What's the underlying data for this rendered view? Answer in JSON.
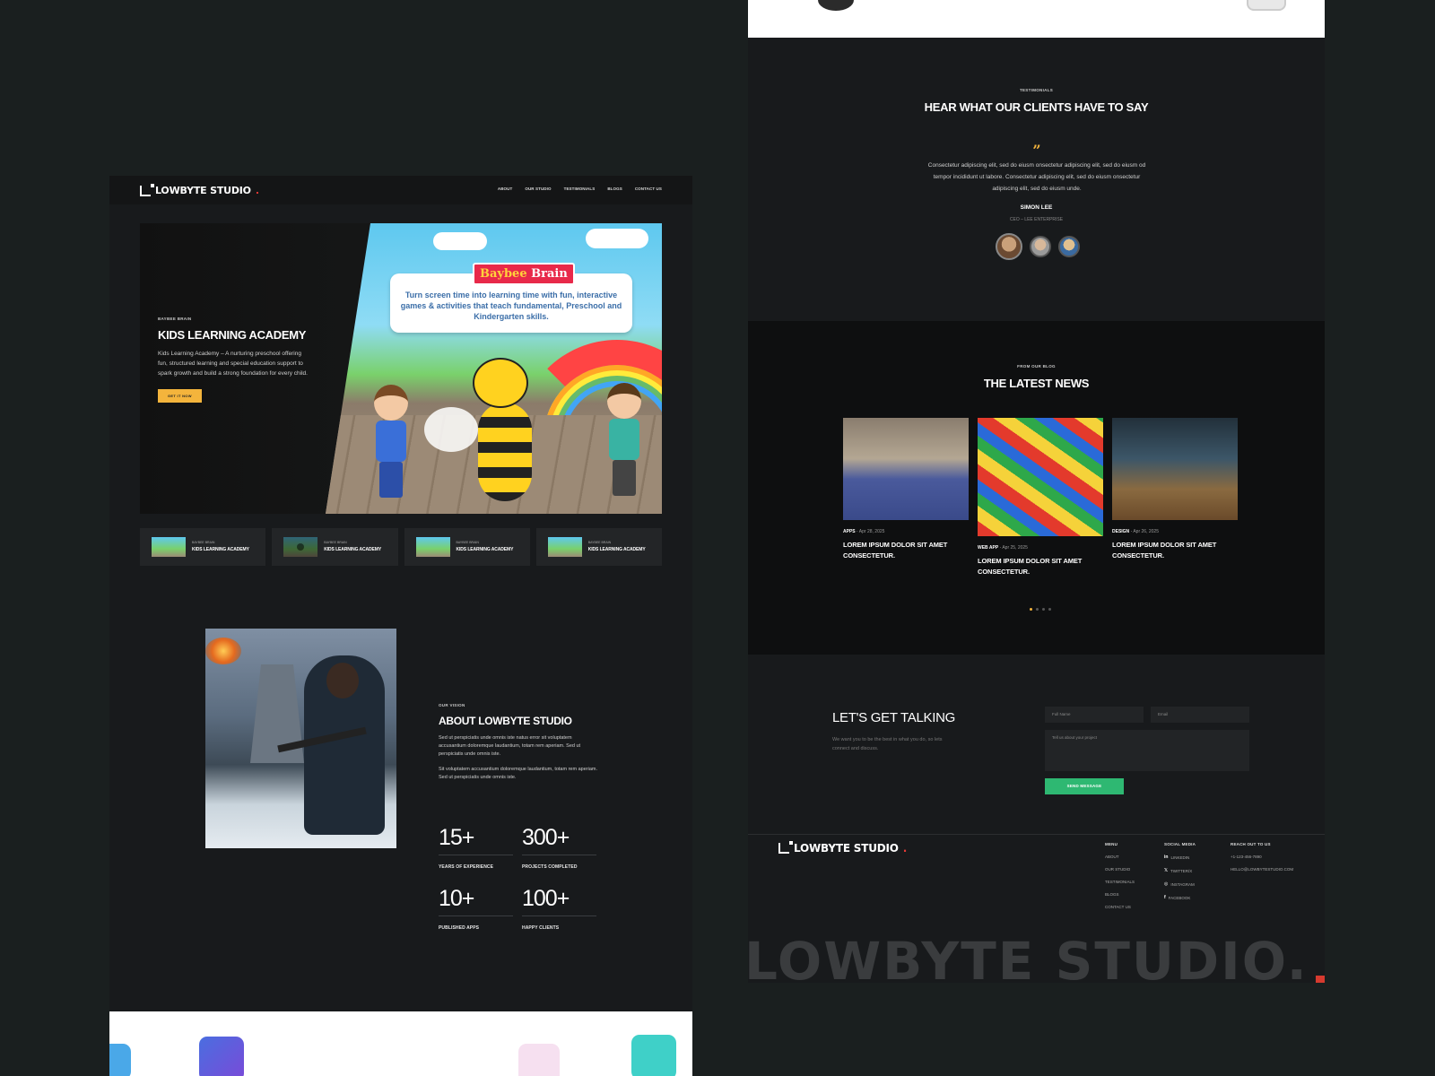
{
  "brand": {
    "name": "LOWBYTE STUDIO",
    "dot": "."
  },
  "nav": {
    "links": [
      "ABOUT",
      "OUR STUDIO",
      "TESTIMONIALS",
      "BLOGS",
      "CONTACT US"
    ]
  },
  "hero": {
    "eyebrow": "BAYBEE BRAIN",
    "title": "KIDS LEARNING ACADEMY",
    "description": "Kids Learning Academy – A nurturing preschool offering fun, structured learning and special education support to spark growth and build a strong foundation for every child.",
    "cta": "GET IT NOW",
    "art_brand_a": "Baybee",
    "art_brand_b": " Brain",
    "art_tagline": "Turn screen time into learning time with fun, interactive games & activities that teach fundamental, Preschool and Kindergarten skills."
  },
  "thumbs": [
    {
      "eyebrow": "BAYBEE BRAIN",
      "title": "KIDS LEARNING ACADEMY",
      "video": false
    },
    {
      "eyebrow": "BAYBEE BRAIN",
      "title": "KIDS LEARNING ACADEMY",
      "video": true
    },
    {
      "eyebrow": "BAYBEE BRAIN",
      "title": "KIDS LEARNING ACADEMY",
      "video": false
    },
    {
      "eyebrow": "BAYBEE BRAIN",
      "title": "KIDS LEARNING ACADEMY",
      "video": false
    }
  ],
  "about": {
    "eyebrow": "OUR VISION",
    "title": "ABOUT LOWBYTE STUDIO",
    "p1": "Sed ut perspiciatis unde omnis iste natus error sit voluptatem accusantium doloremque laudantium, totam rem aperiam. Sed ut perspiciatis unde omnis iste.",
    "p2": "Sit voluptatem accusantium doloremque laudantium, totam rem aperiam. Sed ut perspiciatis unde omnis iste."
  },
  "stats": [
    {
      "num": "15+",
      "label": "YEARS OF EXPERIENCE"
    },
    {
      "num": "300+",
      "label": "PROJECTS COMPLETED"
    },
    {
      "num": "10+",
      "label": "PUBLISHED APPS"
    },
    {
      "num": "100+",
      "label": "HAPPY CLIENTS"
    }
  ],
  "testimonials": {
    "eyebrow": "TESTIMONIALS",
    "title": "HEAR WHAT OUR CLIENTS HAVE TO SAY",
    "quote_mark": "”",
    "body": "Consectetur adipiscing elit, sed do eiusm onsectetur adipiscing elit, sed do eiusm od tempor incididunt ut labore. Consectetur adipiscing elit, sed do eiusm onsectetur adipiscing elit, sed do eiusm unde.",
    "name": "SIMON LEE",
    "role": "CEO – LEE ENTERPRISE"
  },
  "news": {
    "eyebrow": "FROM OUR BLOG",
    "title": "THE LATEST NEWS",
    "posts": [
      {
        "category": "APPS",
        "date": "Apr 28, 2025",
        "title": "LOREM IPSUM DOLOR SIT AMET CONSECTETUR."
      },
      {
        "category": "WEB APP",
        "date": "Apr 25, 2025",
        "title": "LOREM IPSUM DOLOR SIT AMET CONSECTETUR."
      },
      {
        "category": "DESIGN",
        "date": "Apr 26, 2025",
        "title": "LOREM IPSUM DOLOR SIT AMET CONSECTETUR."
      }
    ]
  },
  "contact": {
    "title": "LET'S GET TALKING",
    "subtitle": "We want you to be the best in what you do, so lets connect and discuss.",
    "name_placeholder": "Full Name",
    "email_placeholder": "Email",
    "message_placeholder": "Tell us about your project",
    "submit": "SEND MESSAGE"
  },
  "footer": {
    "menu_heading": "MENU",
    "menu": [
      "ABOUT",
      "OUR STUDIO",
      "TESTIMONIALS",
      "BLOGS",
      "CONTACT US"
    ],
    "social_heading": "SOCIAL MEDIA",
    "social": [
      {
        "icon": "linkedin-icon",
        "glyph": "in",
        "label": "LINKEDIN"
      },
      {
        "icon": "x-icon",
        "glyph": "𝕏",
        "label": "TWITTER/X"
      },
      {
        "icon": "instagram-icon",
        "glyph": "◎",
        "label": "INSTAGRAM"
      },
      {
        "icon": "facebook-icon",
        "glyph": "f",
        "label": "FACEBOOK"
      }
    ],
    "reach_heading": "REACH OUT TO US",
    "phone": "+1-123-456-7890",
    "email": "HELLO@LOWBYTESTUDIO.COM",
    "big_wordmark": "LOWBYTE STUDIO."
  },
  "colors": {
    "page_bg": "#1a1f1f",
    "accent_yellow": "#f4b43c",
    "accent_green": "#2eb872",
    "accent_red": "#d63a2f"
  }
}
